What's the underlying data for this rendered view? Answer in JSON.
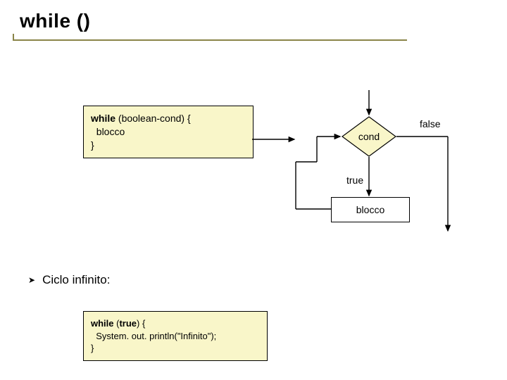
{
  "title": "while ()",
  "code1": {
    "line1_bold": "while",
    "line1_rest": " (boolean-cond) {",
    "line2": "  blocco",
    "line3": "}"
  },
  "flow": {
    "cond": "cond",
    "true": "true",
    "false": "false",
    "process": "blocco"
  },
  "bullet": {
    "text": "Ciclo infinito:"
  },
  "code2": {
    "line1_bold": "while",
    "line1_rest": " (",
    "line1_bold2": "true",
    "line1_rest2": ") {",
    "line2": "  System. out. println(\"Infinito\");",
    "line3": "}"
  }
}
